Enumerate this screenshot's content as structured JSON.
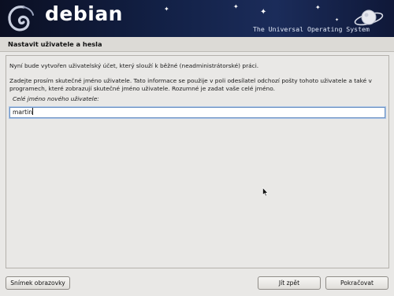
{
  "header": {
    "logo_text": "debian",
    "tagline": "The Universal Operating System",
    "logo_icon": "debian-swirl-icon",
    "decoration_icon": "planet-icon"
  },
  "page": {
    "title": "Nastavit uživatele a hesla"
  },
  "main": {
    "paragraph1": "Nyní bude vytvořen uživatelský účet, který slouží k běžné (neadministrátorské) práci.",
    "paragraph2": "Zadejte prosím skutečné jméno uživatele. Tato informace se použije v poli odesílatel odchozí pošty tohoto uživatele a také v programech, které zobrazují skutečné jméno uživatele. Rozumné je zadat vaše celé jméno.",
    "field_label": "Celé jméno nového uživatele:",
    "field_value": "martin"
  },
  "footer": {
    "screenshot_label": "Snímek obrazovky",
    "back_label": "Jít zpět",
    "continue_label": "Pokračovat"
  },
  "colors": {
    "banner_dark": "#0b0f22",
    "banner_mid": "#1b2c5a",
    "input_border": "#6e93c3"
  }
}
